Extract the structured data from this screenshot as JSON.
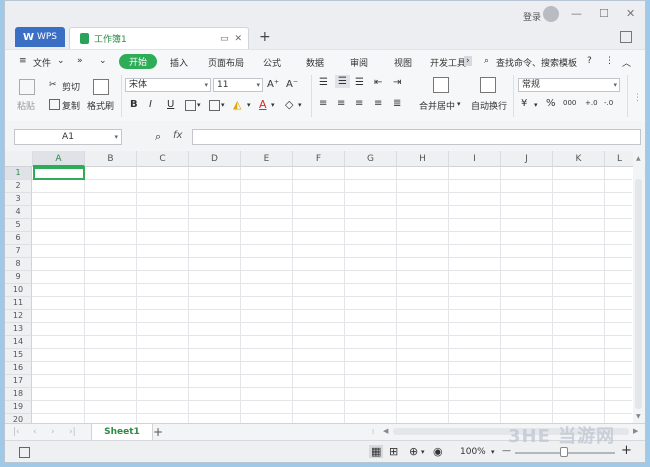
{
  "window": {
    "login_label": "登录",
    "minimize": "—",
    "maximize": "☐",
    "close": "✕"
  },
  "tabs": {
    "wps_label": "WPS",
    "doc_title": "工作簿1",
    "new_tab": "+"
  },
  "menu": {
    "file": "文件",
    "start": "开始",
    "items": [
      "插入",
      "页面布局",
      "公式",
      "数据",
      "审阅",
      "视图",
      "开发工具"
    ],
    "search": "查找命令、搜索模板",
    "help": "?"
  },
  "ribbon": {
    "paste": "粘贴",
    "cut": "剪切",
    "copy": "复制",
    "format_painter": "格式刷",
    "font_name": "宋体",
    "font_size": "11",
    "grow_font": "A⁺",
    "shrink_font": "A⁻",
    "bold": "B",
    "italic": "I",
    "underline": "U",
    "merge_center": "合并居中",
    "auto_wrap": "自动换行",
    "number_format": "常规",
    "currency": "¥",
    "percent": "%",
    "thousands": "000",
    "inc_decimal": "+.0",
    "dec_decimal": "-.0"
  },
  "formula": {
    "cell_ref": "A1",
    "fx": "fx"
  },
  "grid": {
    "columns": [
      "A",
      "B",
      "C",
      "D",
      "E",
      "F",
      "G",
      "H",
      "I",
      "J",
      "K",
      "L"
    ],
    "rows": [
      "1",
      "2",
      "3",
      "4",
      "5",
      "6",
      "7",
      "8",
      "9",
      "10",
      "11",
      "12",
      "13",
      "14",
      "15",
      "16",
      "17",
      "18",
      "19",
      "20"
    ]
  },
  "sheets": {
    "active": "Sheet1",
    "add": "+"
  },
  "status": {
    "zoom": "100%",
    "zoom_out": "—",
    "zoom_in": "+"
  },
  "watermark": "3HE 当游网"
}
